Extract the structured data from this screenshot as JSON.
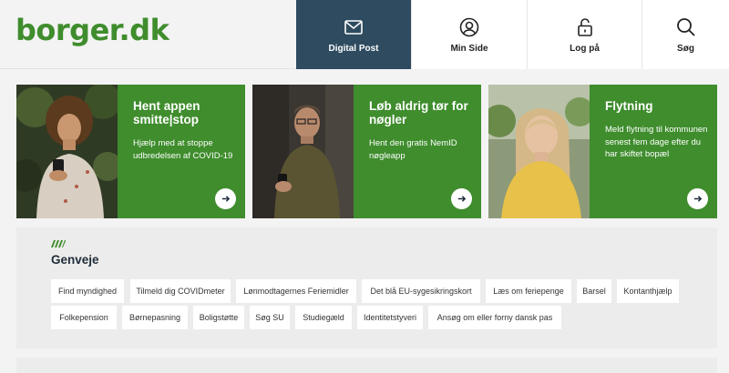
{
  "header": {
    "logo": "borger.dk",
    "nav": [
      {
        "label": "Digital Post",
        "icon": "envelope-icon",
        "active": true
      },
      {
        "label": "Min Side",
        "icon": "user-icon"
      },
      {
        "label": "Log på",
        "icon": "lock-icon"
      },
      {
        "label": "Søg",
        "icon": "search-icon"
      }
    ]
  },
  "cards": [
    {
      "title": "Hent appen smitte|stop",
      "text": "Hjælp med at stoppe udbredelsen af COVID-19"
    },
    {
      "title": "Løb aldrig tør for nøgler",
      "text": "Hent den gratis NemID nøgleapp"
    },
    {
      "title": "Flytning",
      "text": "Meld flytning til kommunen senest fem dage efter du har skiftet bopæl"
    }
  ],
  "shortcuts": {
    "title": "Genveje",
    "items": [
      "Find myndighed",
      "Tilmeld dig COVIDmeter",
      "Lønmodtagernes Feriemidler",
      "Det blå EU-sygesikringskort",
      "Læs om feriepenge",
      "Barsel",
      "Kontanthjælp",
      "Folkepension",
      "Børnepasning",
      "Boligstøtte",
      "Søg SU",
      "Studiegæld",
      "Identitetstyveri",
      "Ansøg om eller forny dansk pas"
    ]
  },
  "colors": {
    "brand_green": "#3f8d2d",
    "nav_active": "#2e4b5f"
  }
}
